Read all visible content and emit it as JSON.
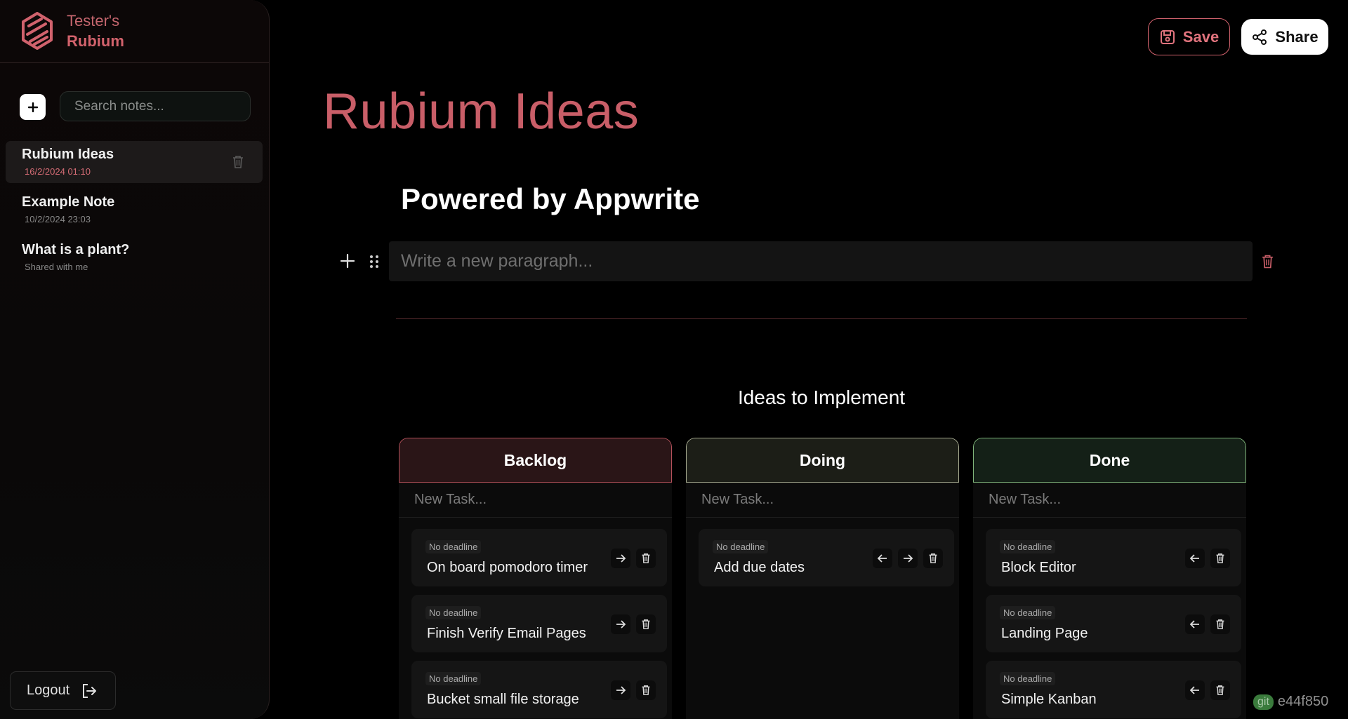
{
  "sidebar": {
    "brand": {
      "line1": "Tester's",
      "line2": "Rubium"
    },
    "search": {
      "placeholder": "Search notes...",
      "value": ""
    },
    "notes": [
      {
        "title": "Rubium Ideas",
        "subtitle": "16/2/2024 01:10",
        "active": true
      },
      {
        "title": "Example Note",
        "subtitle": "10/2/2024 23:03",
        "active": false
      },
      {
        "title": "What is a plant?",
        "subtitle": "Shared with me",
        "active": false
      }
    ],
    "logout_label": "Logout"
  },
  "toolbar": {
    "save_label": "Save",
    "share_label": "Share"
  },
  "document": {
    "title": "Rubium Ideas",
    "heading": "Powered by Appwrite",
    "paragraph_placeholder": "Write a new paragraph...",
    "kanban": {
      "title": "Ideas to Implement",
      "new_task_placeholder": "New Task...",
      "columns": [
        {
          "name": "Backlog",
          "cards": [
            {
              "deadline": "No deadline",
              "title": "On board pomodoro timer"
            },
            {
              "deadline": "No deadline",
              "title": "Finish Verify Email Pages"
            },
            {
              "deadline": "No deadline",
              "title": "Bucket small file storage"
            }
          ]
        },
        {
          "name": "Doing",
          "cards": [
            {
              "deadline": "No deadline",
              "title": "Add due dates"
            }
          ]
        },
        {
          "name": "Done",
          "cards": [
            {
              "deadline": "No deadline",
              "title": "Block Editor"
            },
            {
              "deadline": "No deadline",
              "title": "Landing Page"
            },
            {
              "deadline": "No deadline",
              "title": "Simple Kanban"
            }
          ]
        }
      ]
    }
  },
  "footer": {
    "git_label": "git",
    "git_hash": "e44f850"
  },
  "colors": {
    "accent": "#d1626d",
    "background": "#000000",
    "backlog": "#b3505a",
    "doing": "#a5a98f",
    "done": "#7fb47a"
  }
}
